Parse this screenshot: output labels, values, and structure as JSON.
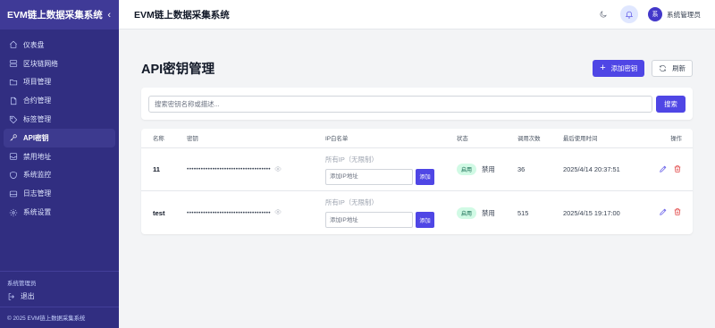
{
  "sidebar": {
    "brand": "EVM链上数据采集系统",
    "collapse_icon": "chevron-left-icon",
    "items": [
      {
        "label": "仪表盘",
        "icon": "home-icon"
      },
      {
        "label": "区块链网络",
        "icon": "network-icon"
      },
      {
        "label": "项目管理",
        "icon": "folder-icon"
      },
      {
        "label": "合约管理",
        "icon": "document-icon"
      },
      {
        "label": "标签管理",
        "icon": "tag-icon"
      },
      {
        "label": "API密钥",
        "icon": "key-icon",
        "active": true
      },
      {
        "label": "禁用地址",
        "icon": "inbox-icon"
      },
      {
        "label": "系统监控",
        "icon": "monitor-icon"
      },
      {
        "label": "日志管理",
        "icon": "log-icon"
      },
      {
        "label": "系统设置",
        "icon": "gear-icon"
      }
    ],
    "user_name": "系统管理员",
    "logout_label": "退出",
    "footer": "© 2025 EVM链上数据采集系统"
  },
  "topbar": {
    "title": "EVM链上数据采集系统",
    "user_initial": "系",
    "user_name": "系统管理员"
  },
  "page": {
    "title": "API密钥管理",
    "add_label": "添加密钥",
    "refresh_label": "刷新"
  },
  "search": {
    "placeholder": "搜索密钥名称或描述...",
    "button_label": "搜索"
  },
  "table": {
    "columns": [
      "名称",
      "密钥",
      "IP白名单",
      "状态",
      "调用次数",
      "最后使用时间",
      "操作"
    ],
    "rows": [
      {
        "name": "11",
        "key_masked": "••••••••••••••••••••••••••••••••••••",
        "ip_all": "所有IP（无限制）",
        "ip_placeholder": "添加IP地址",
        "ip_add_label": "添加",
        "status_enabled": "启用",
        "status_disable": "禁用",
        "calls": "36",
        "last_used": "2025/4/14 20:37:51"
      },
      {
        "name": "test",
        "key_masked": "••••••••••••••••••••••••••••••••••••",
        "ip_all": "所有IP（无限制）",
        "ip_placeholder": "添加IP地址",
        "ip_add_label": "添加",
        "status_enabled": "启用",
        "status_disable": "禁用",
        "calls": "515",
        "last_used": "2025/4/15 19:17:00"
      }
    ]
  },
  "colors": {
    "sidebar_bg": "#312e81",
    "accent": "#4f46e5",
    "success_badge": "#d1fae5",
    "danger": "#dc2626"
  }
}
